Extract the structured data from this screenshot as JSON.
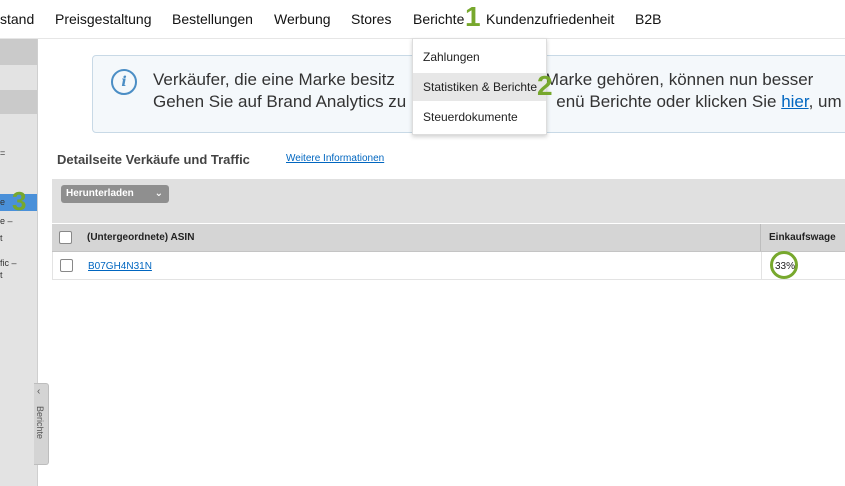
{
  "topnav": {
    "items": [
      {
        "label": "stand"
      },
      {
        "label": "Preisgestaltung"
      },
      {
        "label": "Bestellungen"
      },
      {
        "label": "Werbung"
      },
      {
        "label": "Stores"
      },
      {
        "label": "Berichte"
      },
      {
        "label": "Kundenzufriedenheit"
      },
      {
        "label": "B2B"
      }
    ]
  },
  "markers": {
    "one": "1",
    "two": "2",
    "three": "3"
  },
  "dropdown": {
    "items": [
      {
        "label": "Zahlungen"
      },
      {
        "label": "Statistiken & Berichte"
      },
      {
        "label": "Steuerdokumente"
      }
    ]
  },
  "sidebar": {
    "fragments": [
      "=",
      "e",
      "e –",
      "t",
      "fic –",
      "t"
    ],
    "tab_label": "Berichte",
    "tab_chevron": "‹"
  },
  "info": {
    "icon": "i",
    "line1": "Verkäufer, die eine Marke besitz",
    "line1_after": "Marke gehören, können nun besser",
    "line2_before": "Gehen Sie auf Brand Analytics zu",
    "line2_mid": "enü Berichte oder klicken Sie",
    "link": "hier",
    "line2_end": ", um"
  },
  "report": {
    "title": "Detailseite Verkäufe und Traffic",
    "more_link": "Weitere Informationen",
    "download_label": "Herunterladen",
    "download_chevron": "⌄",
    "columns": [
      "(Untergeordnete) ASIN",
      "Einkaufswage"
    ],
    "rows": [
      {
        "asin": "B07GH4N31N",
        "buybox": "33%"
      }
    ]
  },
  "colors": {
    "marker_green": "#77a82d",
    "link_blue": "#0066c0",
    "highlight_blue": "#4a90d9"
  }
}
